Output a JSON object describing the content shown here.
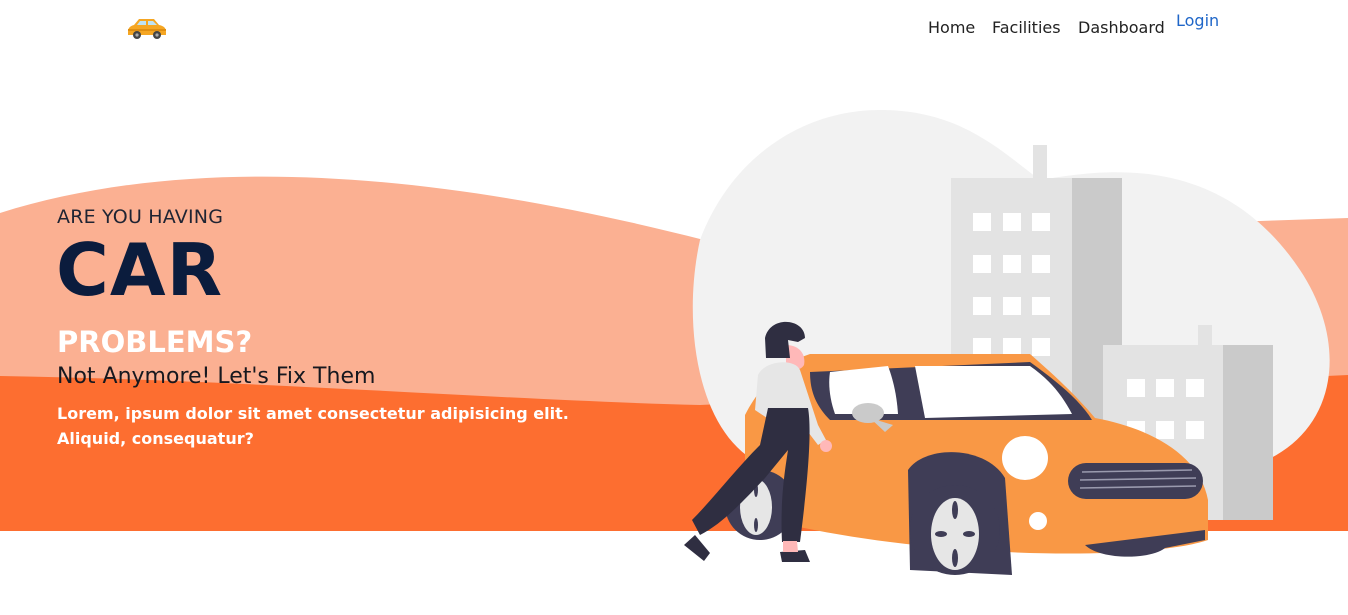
{
  "nav": {
    "logo_icon": "car-logo-icon",
    "links": [
      "Home",
      "Facilities",
      "Dashboard"
    ],
    "login_label": "Login"
  },
  "hero": {
    "kicker": "ARE YOU HAVING",
    "title": "CAR",
    "problems": "PROBLEMS?",
    "subtitle": "Not Anymore! Let's Fix Them",
    "description": "Lorem, ipsum dolor sit amet consectetur adipisicing elit. Aliquid, consequatur?"
  },
  "colors": {
    "light_orange": "#FBB092",
    "dark_orange": "#FD6E30",
    "car_orange": "#F99845",
    "title_navy": "#0B1C3D",
    "login_blue": "#1F66C8",
    "blob_gray": "#F2F2F2"
  }
}
